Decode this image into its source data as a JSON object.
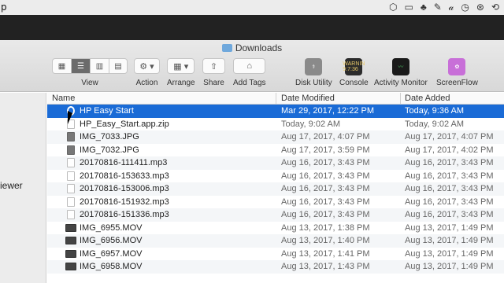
{
  "menubar": {
    "app_name": "p",
    "status_icons": [
      "dropbox-icon",
      "battery-icon",
      "evernote-icon",
      "wifi-icon",
      "cursive-a-icon",
      "clock-icon",
      "accessibility-icon",
      "bluetooth-icon"
    ]
  },
  "window": {
    "title": "Downloads",
    "sidebar": {
      "visible_item": "iewer"
    },
    "toolbar": {
      "view_label": "View",
      "action_label": "Action",
      "arrange_label": "Arrange",
      "share_label": "Share",
      "addtags_label": "Add Tags",
      "apps": [
        {
          "label": "Disk Utility",
          "color": "#8a8a8a",
          "text": ""
        },
        {
          "label": "Console",
          "color": "#2b2b2b",
          "text": "WARNIN 9:7:36"
        },
        {
          "label": "Activity Monitor",
          "color": "#1a1a1a",
          "text": ""
        },
        {
          "label": "ScreenFlow",
          "color": "#c86fd8",
          "text": ""
        }
      ]
    },
    "columns": {
      "name": "Name",
      "modified": "Date Modified",
      "added": "Date Added"
    },
    "files": [
      {
        "name": "HP Easy Start",
        "modified": "Mar 29, 2017, 12:22 PM",
        "added": "Today, 9:36 AM",
        "kind": "app"
      },
      {
        "name": "HP_Easy_Start.app.zip",
        "modified": "Today, 9:02 AM",
        "added": "Today, 9:02 AM",
        "kind": "doc"
      },
      {
        "name": "IMG_7033.JPG",
        "modified": "Aug 17, 2017, 4:07 PM",
        "added": "Aug 17, 2017, 4:07 PM",
        "kind": "img"
      },
      {
        "name": "IMG_7032.JPG",
        "modified": "Aug 17, 2017, 3:59 PM",
        "added": "Aug 17, 2017, 4:02 PM",
        "kind": "img"
      },
      {
        "name": "20170816-111411.mp3",
        "modified": "Aug 16, 2017, 3:43 PM",
        "added": "Aug 16, 2017, 3:43 PM",
        "kind": "doc"
      },
      {
        "name": "20170816-153633.mp3",
        "modified": "Aug 16, 2017, 3:43 PM",
        "added": "Aug 16, 2017, 3:43 PM",
        "kind": "doc"
      },
      {
        "name": "20170816-153006.mp3",
        "modified": "Aug 16, 2017, 3:43 PM",
        "added": "Aug 16, 2017, 3:43 PM",
        "kind": "doc"
      },
      {
        "name": "20170816-151932.mp3",
        "modified": "Aug 16, 2017, 3:43 PM",
        "added": "Aug 16, 2017, 3:43 PM",
        "kind": "doc"
      },
      {
        "name": "20170816-151336.mp3",
        "modified": "Aug 16, 2017, 3:43 PM",
        "added": "Aug 16, 2017, 3:43 PM",
        "kind": "doc"
      },
      {
        "name": "IMG_6955.MOV",
        "modified": "Aug 13, 2017, 1:38 PM",
        "added": "Aug 13, 2017, 1:49 PM",
        "kind": "mov"
      },
      {
        "name": "IMG_6956.MOV",
        "modified": "Aug 13, 2017, 1:40 PM",
        "added": "Aug 13, 2017, 1:49 PM",
        "kind": "mov"
      },
      {
        "name": "IMG_6957.MOV",
        "modified": "Aug 13, 2017, 1:41 PM",
        "added": "Aug 13, 2017, 1:49 PM",
        "kind": "mov"
      },
      {
        "name": "IMG_6958.MOV",
        "modified": "Aug 13, 2017, 1:43 PM",
        "added": "Aug 13, 2017, 1:49 PM",
        "kind": "mov"
      }
    ]
  }
}
